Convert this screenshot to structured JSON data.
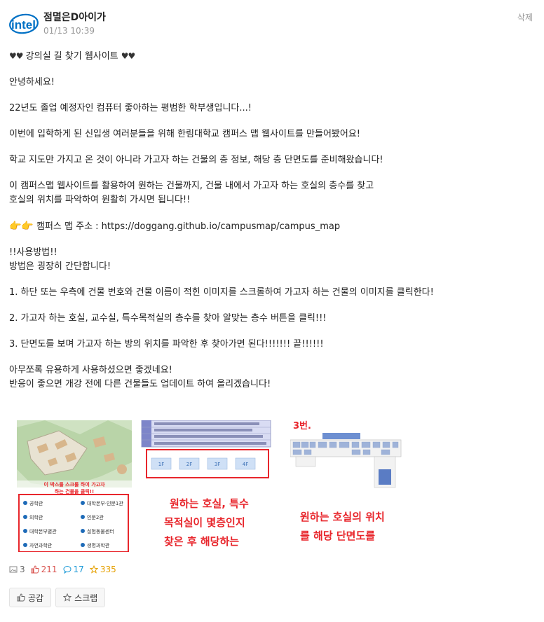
{
  "post": {
    "author": "점멸은D아이가",
    "date": "01/13 10:39",
    "delete_label": "삭제",
    "avatar_text": "intel",
    "title_text": "강의실 길 찾기 웹사이트",
    "paragraphs": [
      "안녕하세요!",
      "22년도 졸업 예정자인 컴퓨터 좋아하는 평범한 학부생입니다...!",
      "이번에 입학하게 된 신입생 여러분들을 위해 한림대학교 캠퍼스 맵 웹사이트를 만들어봤어요!",
      "학교 지도만 가지고 온 것이 아니라 가고자 하는 건물의 층 정보, 해당 층 단면도를 준비해왔습니다!",
      "이 캠퍼스맵 웹사이트를 활용하여 원하는 건물까지, 건물 내에서 가고자 하는 호실의 층수를 찾고",
      "호실의 위치를 파악하여 원활히 가시면 됩니다!!"
    ],
    "link_label": "캠퍼스 맵 주소 : https://doggang.github.io/campusmap/campus_map",
    "usage_title": "!!사용방법!!",
    "usage_sub": "방법은 굉장히 간단합니다!",
    "steps": [
      "1. 하단 또는 우측에 건물 번호와 건물 이름이 적힌 이미지를 스크롤하여 가고자 하는 건물의 이미지를 클릭한다!",
      "2. 가고자 하는 호실, 교수실, 특수목적실의 층수를 찾아 알맞는 층수 버튼을 클릭!!!",
      "3. 단면도를 보며 가고자 하는 방의 위치를 파악한 후 찾아가면 된다!!!!!!! 끝!!!!!!"
    ],
    "closing": [
      "아무쪼록 유용하게 사용하셨으면 좋겠네요!",
      "반응이 좋으면 개강 전에 다른 건물들도 업데이트 하여 올리겠습니다!"
    ]
  },
  "images": {
    "img1": {
      "banner": "이 박스를 스크롤 하여 가고자",
      "banner2": "하는 건물을 클릭!!",
      "buildings_left": [
        "공학관",
        "의학관",
        "대학본부별관",
        "자연과학관"
      ],
      "buildings_right": [
        "대학본부·인문1관",
        "인문2관",
        "실험동물센터",
        "생명과학관"
      ]
    },
    "img2": {
      "floor_buttons": [
        "1F",
        "2F",
        "3F",
        "4F"
      ],
      "caption": [
        "원하는 호실, 특수",
        "목적실이 몇층인지",
        "찾은 후 해당하는"
      ]
    },
    "img3": {
      "top_label": "3번.",
      "caption": [
        "원하는 호실의 위치",
        "를 해당 단면도를"
      ]
    }
  },
  "stats": {
    "images": "3",
    "likes": "211",
    "comments": "17",
    "scraps": "335"
  },
  "actions": {
    "like_label": "공감",
    "scrap_label": "스크랩"
  },
  "colors": {
    "like": "#d9534f",
    "comment": "#1e9bd8",
    "scrap": "#e5a000",
    "accent_red": "#e8262c"
  }
}
